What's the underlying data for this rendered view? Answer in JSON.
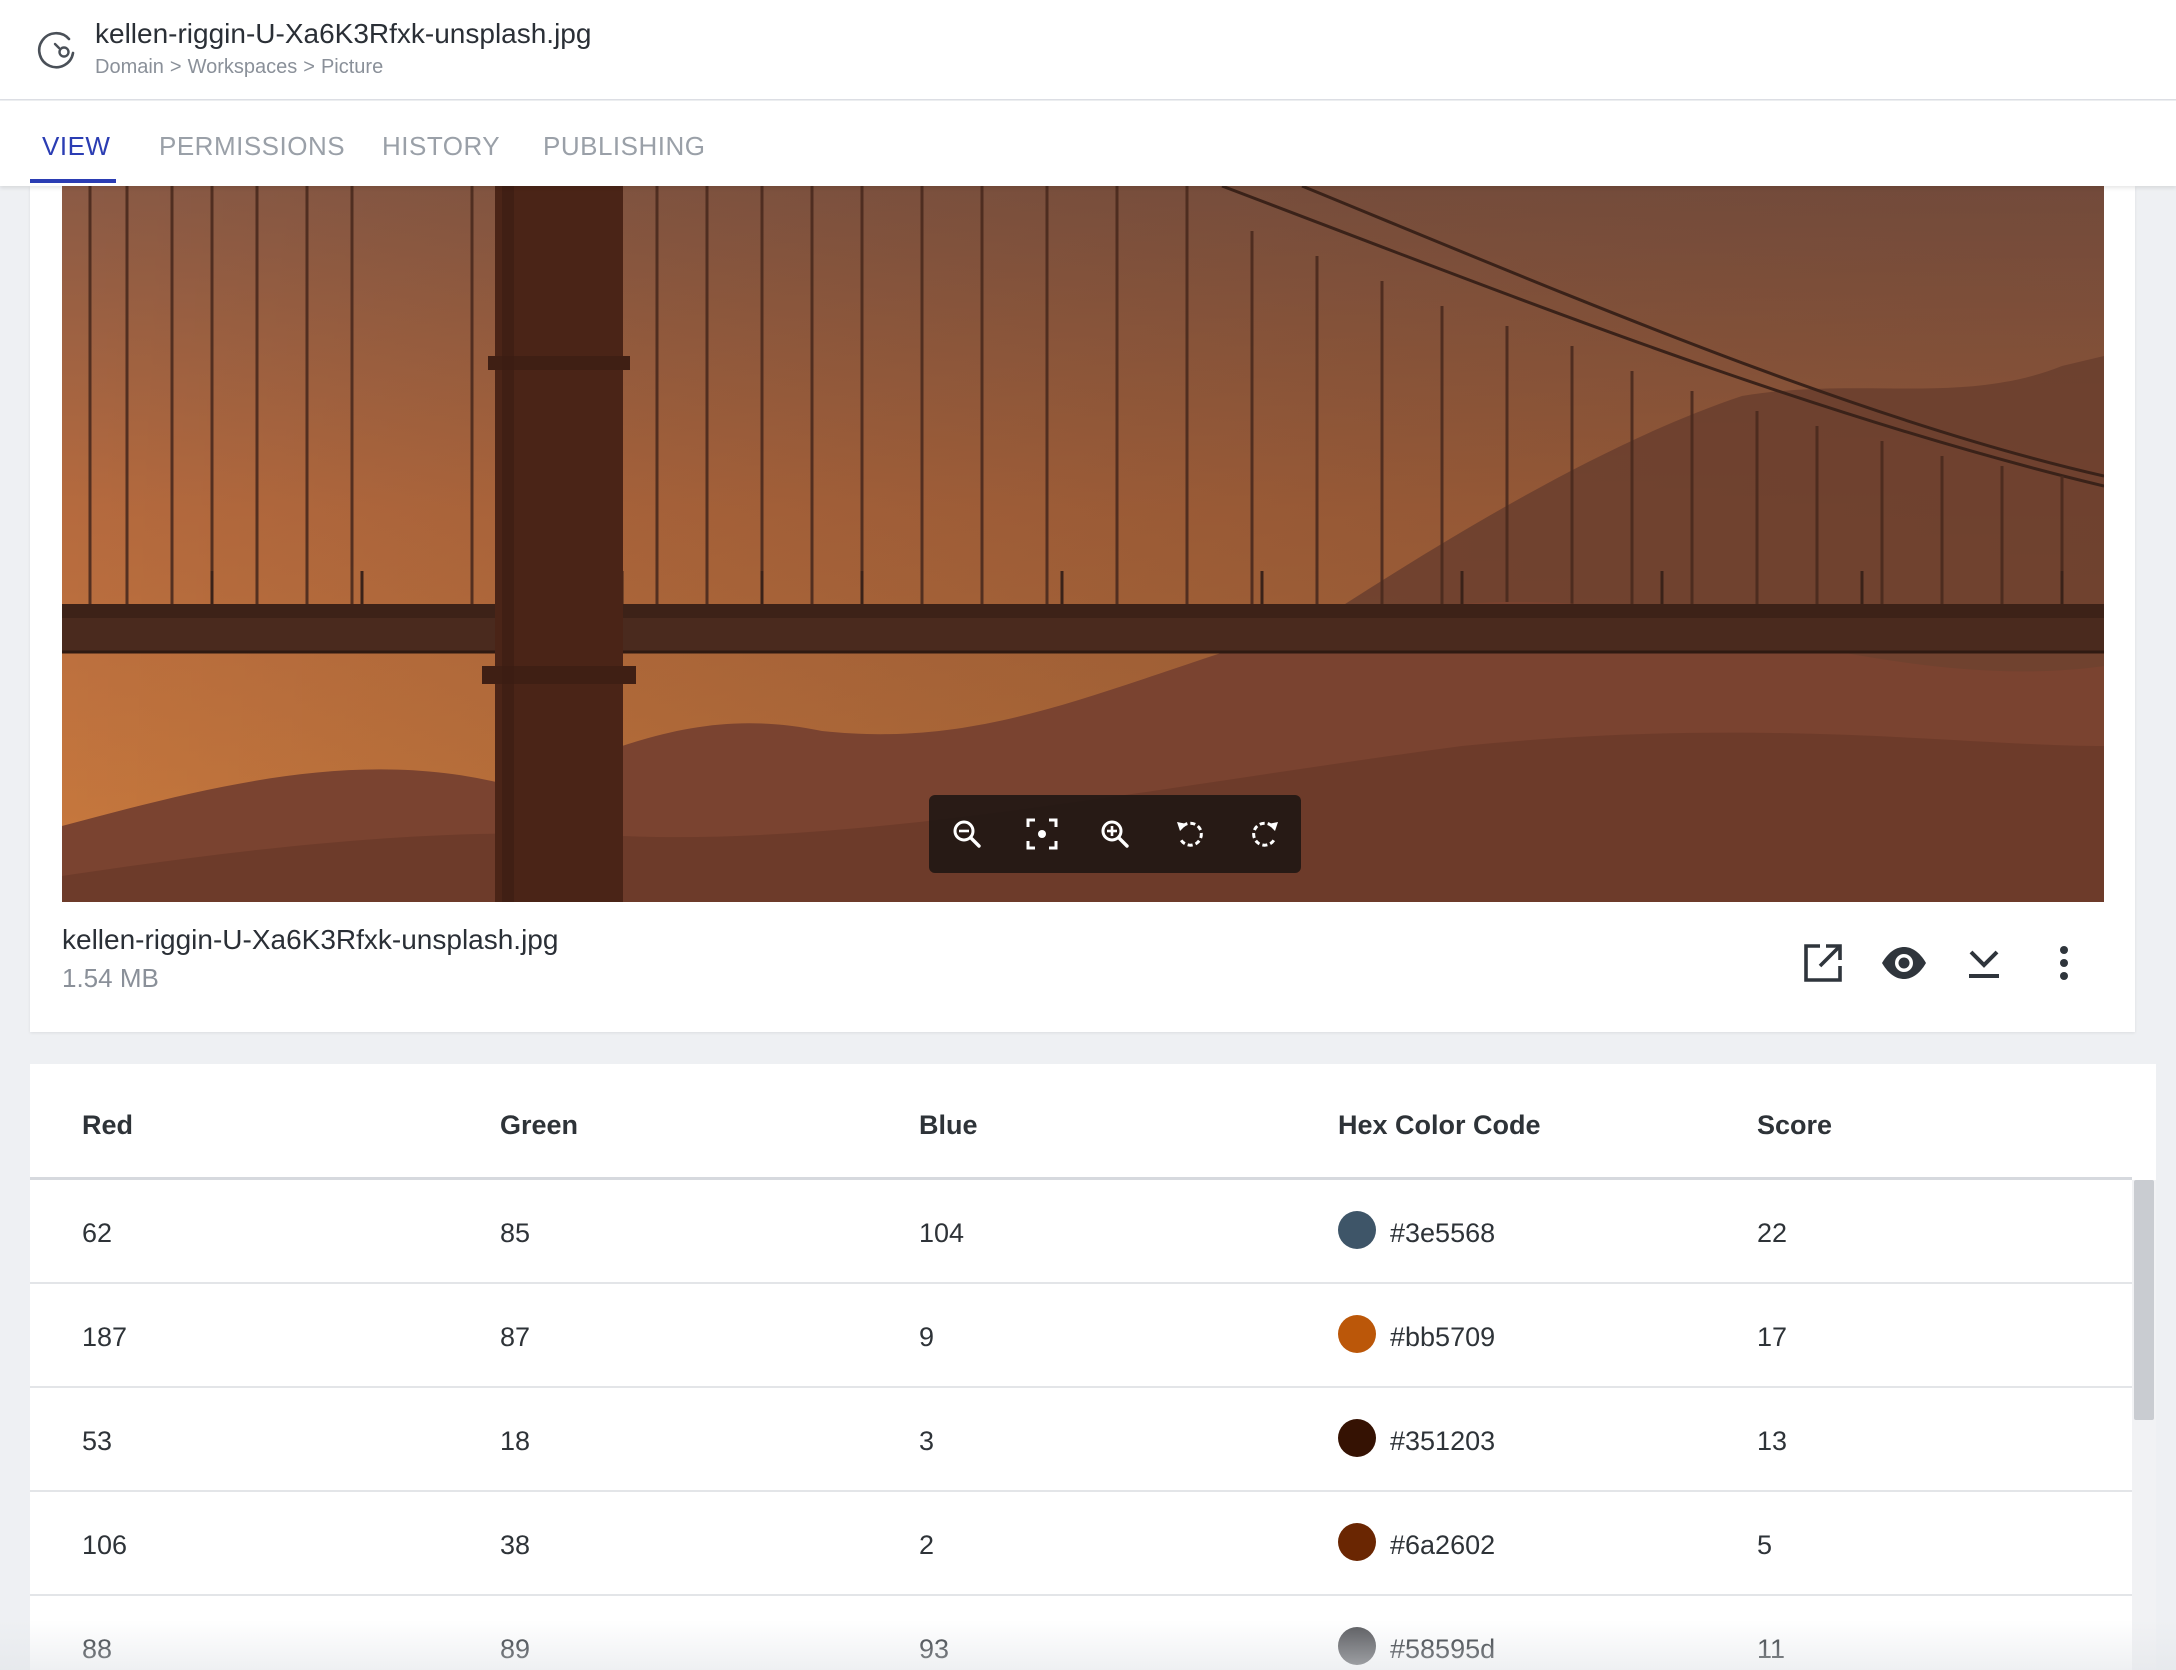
{
  "header": {
    "title": "kellen-riggin-U-Xa6K3Rfxk-unsplash.jpg",
    "breadcrumb": [
      "Domain",
      "Workspaces",
      "Picture"
    ],
    "breadcrumb_separator": ">"
  },
  "tabs": [
    {
      "label": "VIEW",
      "active": true
    },
    {
      "label": "PERMISSIONS",
      "active": false
    },
    {
      "label": "HISTORY",
      "active": false
    },
    {
      "label": "PUBLISHING",
      "active": false
    }
  ],
  "viewer": {
    "toolbar_icons": [
      "zoom-out-icon",
      "fit-screen-icon",
      "zoom-in-icon",
      "rotate-left-icon",
      "rotate-right-icon"
    ]
  },
  "file": {
    "name": "kellen-riggin-U-Xa6K3Rfxk-unsplash.jpg",
    "size": "1.54 MB",
    "action_icons": [
      "open-in-new-icon",
      "eye-icon",
      "download-icon",
      "more-vert-icon"
    ]
  },
  "colors": {
    "accent": "#2b3db3"
  },
  "table": {
    "headers": [
      "Red",
      "Green",
      "Blue",
      "Hex Color Code",
      "Score"
    ],
    "rows": [
      {
        "red": "62",
        "green": "85",
        "blue": "104",
        "hex": "#3e5568",
        "score": "22"
      },
      {
        "red": "187",
        "green": "87",
        "blue": "9",
        "hex": "#bb5709",
        "score": "17"
      },
      {
        "red": "53",
        "green": "18",
        "blue": "3",
        "hex": "#351203",
        "score": "13"
      },
      {
        "red": "106",
        "green": "38",
        "blue": "2",
        "hex": "#6a2602",
        "score": "5"
      },
      {
        "red": "88",
        "green": "89",
        "blue": "93",
        "hex": "#58595d",
        "score": "11"
      }
    ]
  }
}
